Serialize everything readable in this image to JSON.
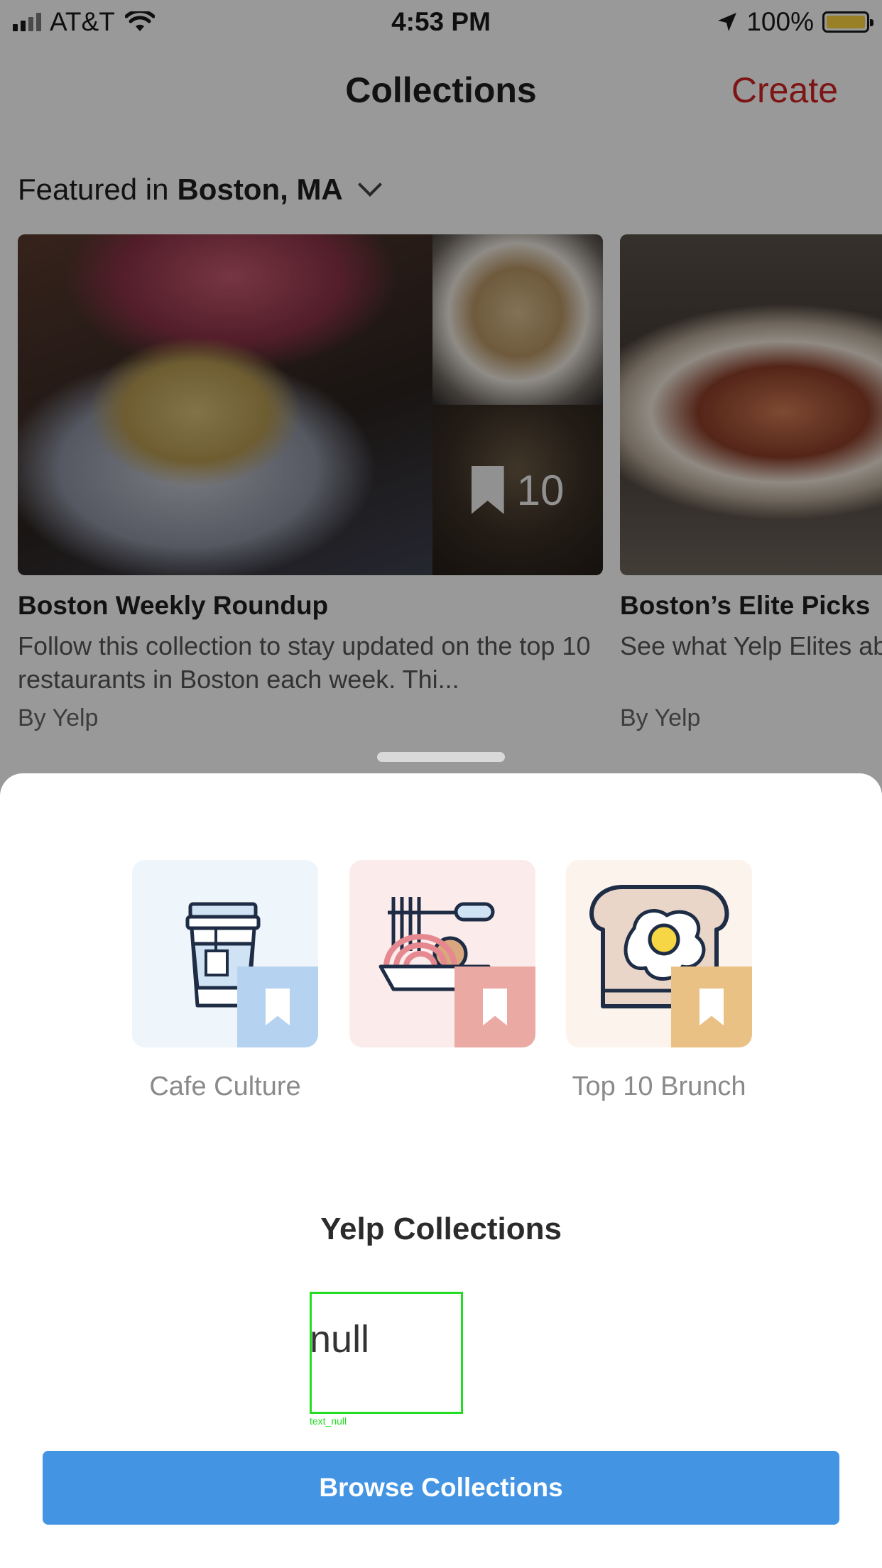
{
  "status_bar": {
    "carrier": "AT&T",
    "time": "4:53 PM",
    "battery": "100%"
  },
  "nav": {
    "title": "Collections",
    "create_label": "Create"
  },
  "featured": {
    "prefix": "Featured in",
    "location": "Boston, MA"
  },
  "cards": [
    {
      "title": "Boston Weekly Roundup",
      "description": "Follow this collection to stay updated on the top 10 restaurants in Boston each week. Thi...",
      "author": "By Yelp",
      "bookmark_count": "10"
    },
    {
      "title": "Boston’s Elite Picks",
      "description": "See what Yelp Elites about in Boston this",
      "author": "By Yelp"
    }
  ],
  "sheet": {
    "tiles": [
      {
        "label": "Cafe Culture",
        "icon": "coffee-cup-icon",
        "color": "#b5d3f1"
      },
      {
        "label": "",
        "icon": "pasta-bowl-icon",
        "color": "#eaa9a3"
      },
      {
        "label": "Top 10 Brunch",
        "icon": "toast-egg-icon",
        "color": "#e9c184"
      }
    ],
    "heading": "Yelp Collections",
    "placeholder_text": "null",
    "placeholder_caption": "text_null",
    "browse_label": "Browse Collections"
  },
  "colors": {
    "accent_red": "#d32323",
    "button_blue": "#4395e4"
  }
}
